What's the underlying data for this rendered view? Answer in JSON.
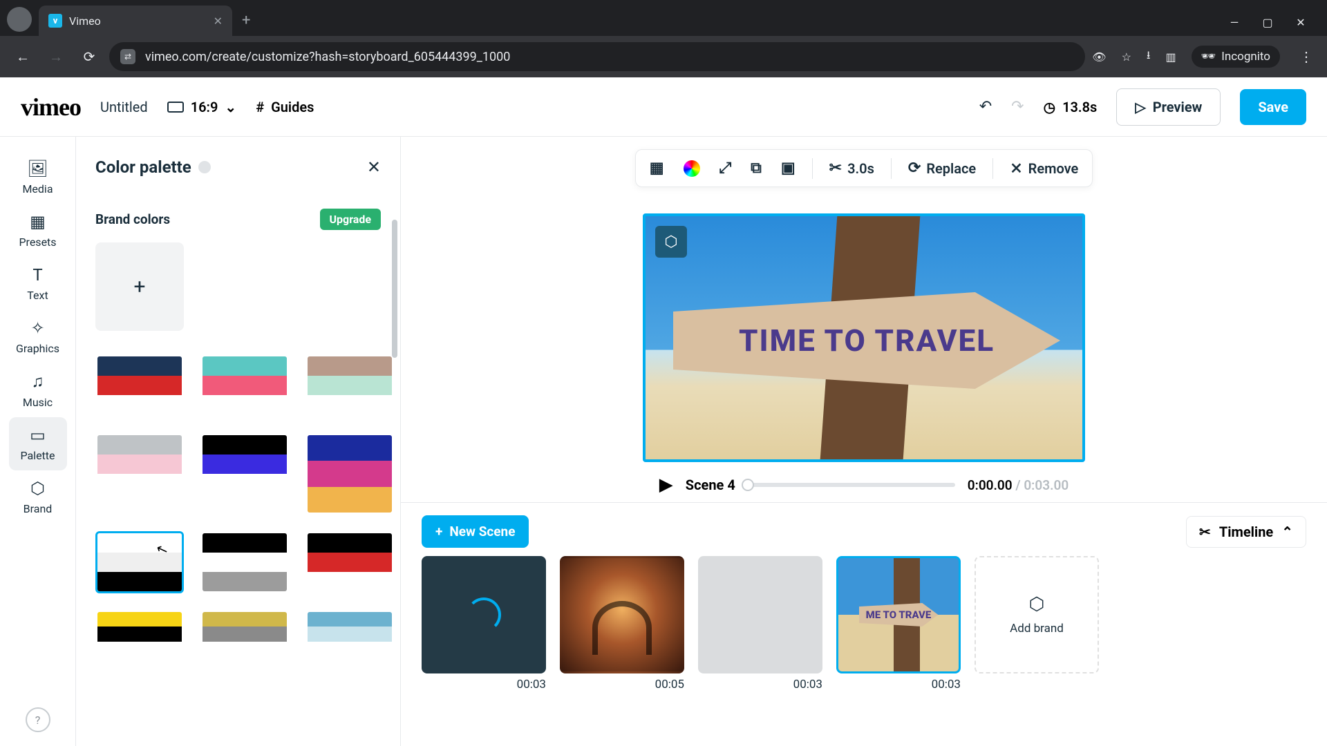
{
  "browser": {
    "tab_title": "Vimeo",
    "url": "vimeo.com/create/customize?hash=storyboard_605444399_1000",
    "incognito_label": "Incognito"
  },
  "topbar": {
    "logo_text": "vimeo",
    "title": "Untitled",
    "ratio": "16:9",
    "guides": "Guides",
    "duration": "13.8s",
    "preview": "Preview",
    "save": "Save"
  },
  "rail": {
    "items": [
      {
        "id": "media",
        "label": "Media"
      },
      {
        "id": "presets",
        "label": "Presets"
      },
      {
        "id": "text",
        "label": "Text"
      },
      {
        "id": "graphics",
        "label": "Graphics"
      },
      {
        "id": "music",
        "label": "Music"
      },
      {
        "id": "palette",
        "label": "Palette"
      },
      {
        "id": "brand",
        "label": "Brand"
      }
    ],
    "active": "palette"
  },
  "panel": {
    "title": "Color palette",
    "brand_colors_label": "Brand colors",
    "upgrade_label": "Upgrade",
    "palettes": [
      {
        "colors": [
          "#1d3557",
          "#d62828",
          "#ffffff"
        ]
      },
      {
        "colors": [
          "#5bc7c2",
          "#f15a7a",
          "#ffffff"
        ]
      },
      {
        "colors": [
          "#b89a8a",
          "#b9e4d3",
          "#ffffff"
        ]
      },
      {
        "colors": [
          "#bfc3c6",
          "#f6c7d4",
          "#ffffff"
        ]
      },
      {
        "colors": [
          "#000000",
          "#3a2be0",
          "#ffffff"
        ]
      },
      {
        "colors": [
          "#1b2b9e",
          "#d43a8c",
          "#f1b44c"
        ]
      },
      {
        "colors": [
          "#ffffff",
          "#efefef",
          "#000000"
        ],
        "selected": true
      },
      {
        "colors": [
          "#000000",
          "#ffffff",
          "#9c9c9c"
        ]
      },
      {
        "colors": [
          "#000000",
          "#d62828",
          "#ffffff"
        ]
      },
      {
        "colors": [
          "#f7d415",
          "#000000",
          "#ffffff"
        ]
      },
      {
        "colors": [
          "#d0b84a",
          "#8a8a8a",
          "#ffffff"
        ]
      },
      {
        "colors": [
          "#6cb2cf",
          "#c7e3ec",
          "#ffffff"
        ]
      }
    ]
  },
  "context": {
    "trim_duration": "3.0s",
    "replace": "Replace",
    "remove": "Remove"
  },
  "stage": {
    "sign_text": "TIME TO TRAVEL",
    "scene_label": "Scene 4",
    "current_time": "0:00.00",
    "duration_sep": " / ",
    "duration": "0:03.00"
  },
  "bottom": {
    "new_scene": "New Scene",
    "timeline": "Timeline",
    "add_brand": "Add brand",
    "scenes": [
      {
        "time": "00:03",
        "kind": "dark"
      },
      {
        "time": "00:05",
        "kind": "concert"
      },
      {
        "time": "00:03",
        "kind": "blank"
      },
      {
        "time": "00:03",
        "kind": "travel",
        "selected": true,
        "thumb_text": "ME TO TRAVE"
      }
    ]
  }
}
